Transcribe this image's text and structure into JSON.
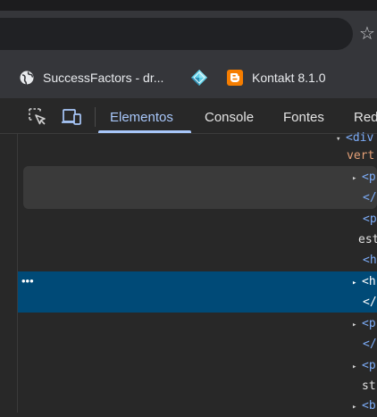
{
  "bookmarks": [
    {
      "label": "SuccessFactors - dr...",
      "icon": "globe-icon"
    },
    {
      "label": "",
      "icon": "diamond-app-icon"
    },
    {
      "label": "Kontakt 8.1.0",
      "icon": "blogger-icon"
    }
  ],
  "devtools": {
    "tabs": [
      "Elementos",
      "Console",
      "Fontes",
      "Red"
    ],
    "active_tab": "Elementos",
    "selected_row_ellipsis": "•••",
    "dom_lines": [
      {
        "prefix": "▾",
        "text": "<div"
      },
      {
        "prefix": "",
        "text": "vert"
      },
      {
        "prefix": "▸",
        "text": "<p"
      },
      {
        "prefix": "",
        "text": "</"
      },
      {
        "prefix": "",
        "text": "<p"
      },
      {
        "prefix": "",
        "text": "est"
      },
      {
        "prefix": "",
        "text": "<h"
      },
      {
        "prefix": "▸",
        "text": "<h"
      },
      {
        "prefix": "",
        "text": "</"
      },
      {
        "prefix": "▸",
        "text": "<p"
      },
      {
        "prefix": "",
        "text": "</"
      },
      {
        "prefix": "▸",
        "text": "<p"
      },
      {
        "prefix": "",
        "text": "st"
      },
      {
        "prefix": "▸",
        "text": "<b"
      }
    ]
  },
  "colors": {
    "accent": "#a8c7fa",
    "selection": "#004a77",
    "tag": "#7cacf8",
    "attr_text": "#e4a077"
  }
}
